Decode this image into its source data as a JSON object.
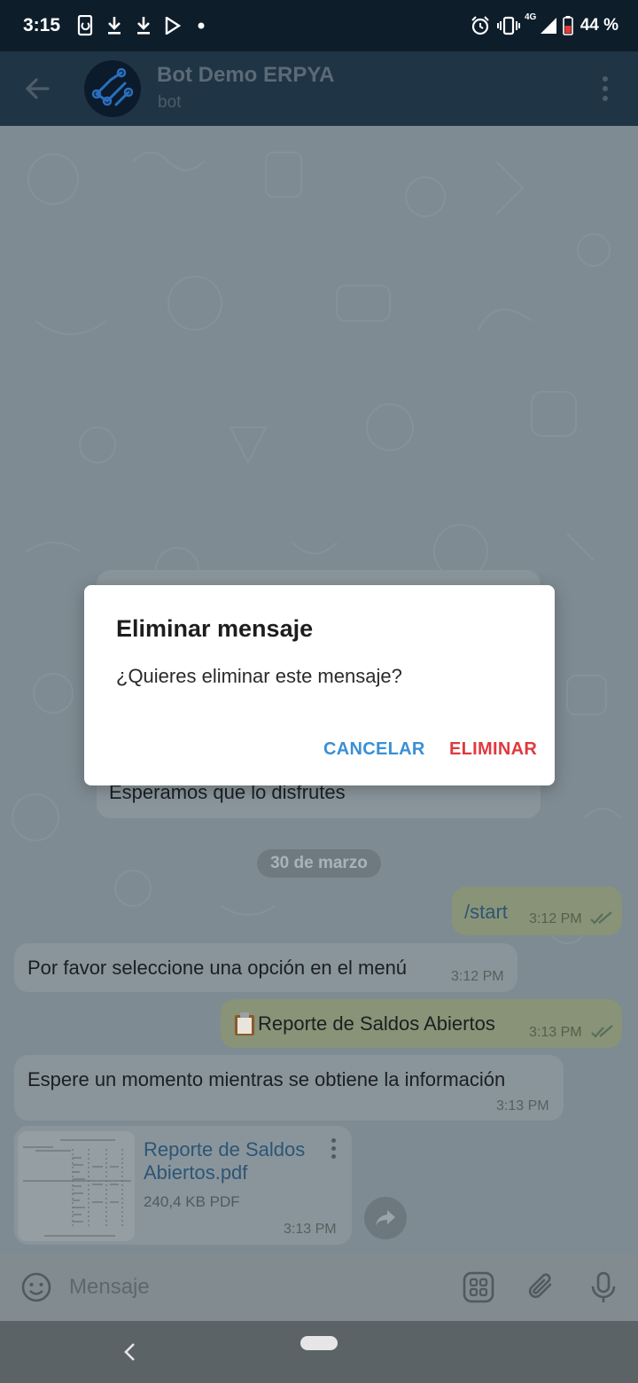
{
  "status_bar": {
    "time": "3:15",
    "network": "4G",
    "battery": "44 %",
    "icons": [
      "screenshot-icon",
      "download-icon",
      "download-icon",
      "play-store-icon",
      "dot-icon",
      "alarm-icon",
      "vibrate-icon",
      "signal-icon",
      "battery-icon"
    ]
  },
  "header": {
    "title": "Bot Demo ERPYA",
    "subtitle": "bot"
  },
  "chat": {
    "hidden_message_tail": "Esperamos que lo disfrutes",
    "date_separator": "30 de marzo",
    "messages": [
      {
        "direction": "out",
        "text": "/start",
        "time": "3:12 PM"
      },
      {
        "direction": "in",
        "text": "Por favor seleccione una opción en el menú",
        "time": "3:12 PM"
      },
      {
        "direction": "out",
        "text": "Reporte de Saldos Abiertos",
        "icon": "clipboard-emoji",
        "time": "3:13 PM"
      },
      {
        "direction": "in",
        "text": "Espere un momento mientras se obtiene la información",
        "time": "3:13 PM"
      }
    ],
    "file": {
      "name_line1": "Reporte de Saldos",
      "name_line2": "Abiertos.pdf",
      "size": "240,4 KB PDF",
      "time": "3:13 PM"
    }
  },
  "input": {
    "placeholder": "Mensaje"
  },
  "dialog": {
    "title": "Eliminar mensaje",
    "message": "¿Quieres eliminar este mensaje?",
    "cancel": "CANCELAR",
    "confirm": "ELIMINAR"
  },
  "colors": {
    "header_bg": "#1f3445",
    "status_bar_bg": "#0e1d2a",
    "cancel_blue": "#3b8fd4",
    "delete_red": "#e0393e",
    "file_link": "#2c5576"
  }
}
